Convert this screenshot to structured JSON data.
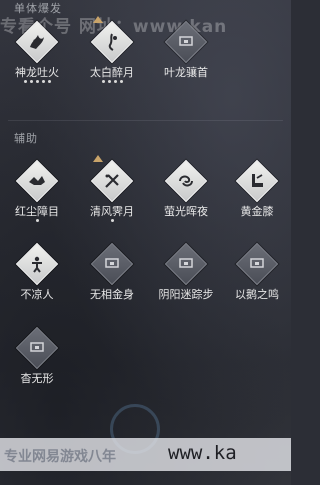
{
  "sections": [
    {
      "title": "单体爆发"
    },
    {
      "title": "辅助"
    }
  ],
  "top_watermark": "专看个号 网址：www.kan",
  "bottom_watermark": "专业网易游戏八年",
  "bottom_url": "www.ka",
  "skills": [
    {
      "name": "神龙吐火",
      "state": "active",
      "icon": "dragon-fire-icon",
      "dots": 5,
      "crown": false
    },
    {
      "name": "太白醉月",
      "state": "active",
      "icon": "drunk-moon-icon",
      "dots": 4,
      "crown": true
    },
    {
      "name": "叶龙骧首",
      "state": "locked",
      "icon": "lock-icon",
      "dots": 0,
      "crown": false
    },
    {
      "name": "红尘障目",
      "state": "active",
      "icon": "dust-veil-icon",
      "dots": 1,
      "crown": false
    },
    {
      "name": "清风霁月",
      "state": "active",
      "icon": "breeze-moon-icon",
      "dots": 1,
      "crown": true
    },
    {
      "name": "萤光晖夜",
      "state": "active",
      "icon": "firefly-swirl-icon",
      "dots": 0,
      "crown": false
    },
    {
      "name": "黄金膝",
      "state": "active",
      "icon": "golden-knee-icon",
      "dots": 0,
      "crown": false
    },
    {
      "name": "不凉人",
      "state": "active",
      "icon": "figure-burst-icon",
      "dots": 0,
      "crown": false
    },
    {
      "name": "无相金身",
      "state": "locked",
      "icon": "lock-icon",
      "dots": 0,
      "crown": false
    },
    {
      "name": "阴阳迷踪步",
      "state": "locked",
      "icon": "lock-icon",
      "dots": 0,
      "crown": false
    },
    {
      "name": "以鹅之鸣",
      "state": "locked",
      "icon": "lock-icon",
      "dots": 0,
      "crown": false
    },
    {
      "name": "杳无形",
      "state": "locked",
      "icon": "lock-icon",
      "dots": 0,
      "crown": false
    }
  ],
  "colors": {
    "crown": "#c9a46a",
    "active_diamond": "#f1f1ef",
    "locked_diamond": "#6b6e77"
  }
}
